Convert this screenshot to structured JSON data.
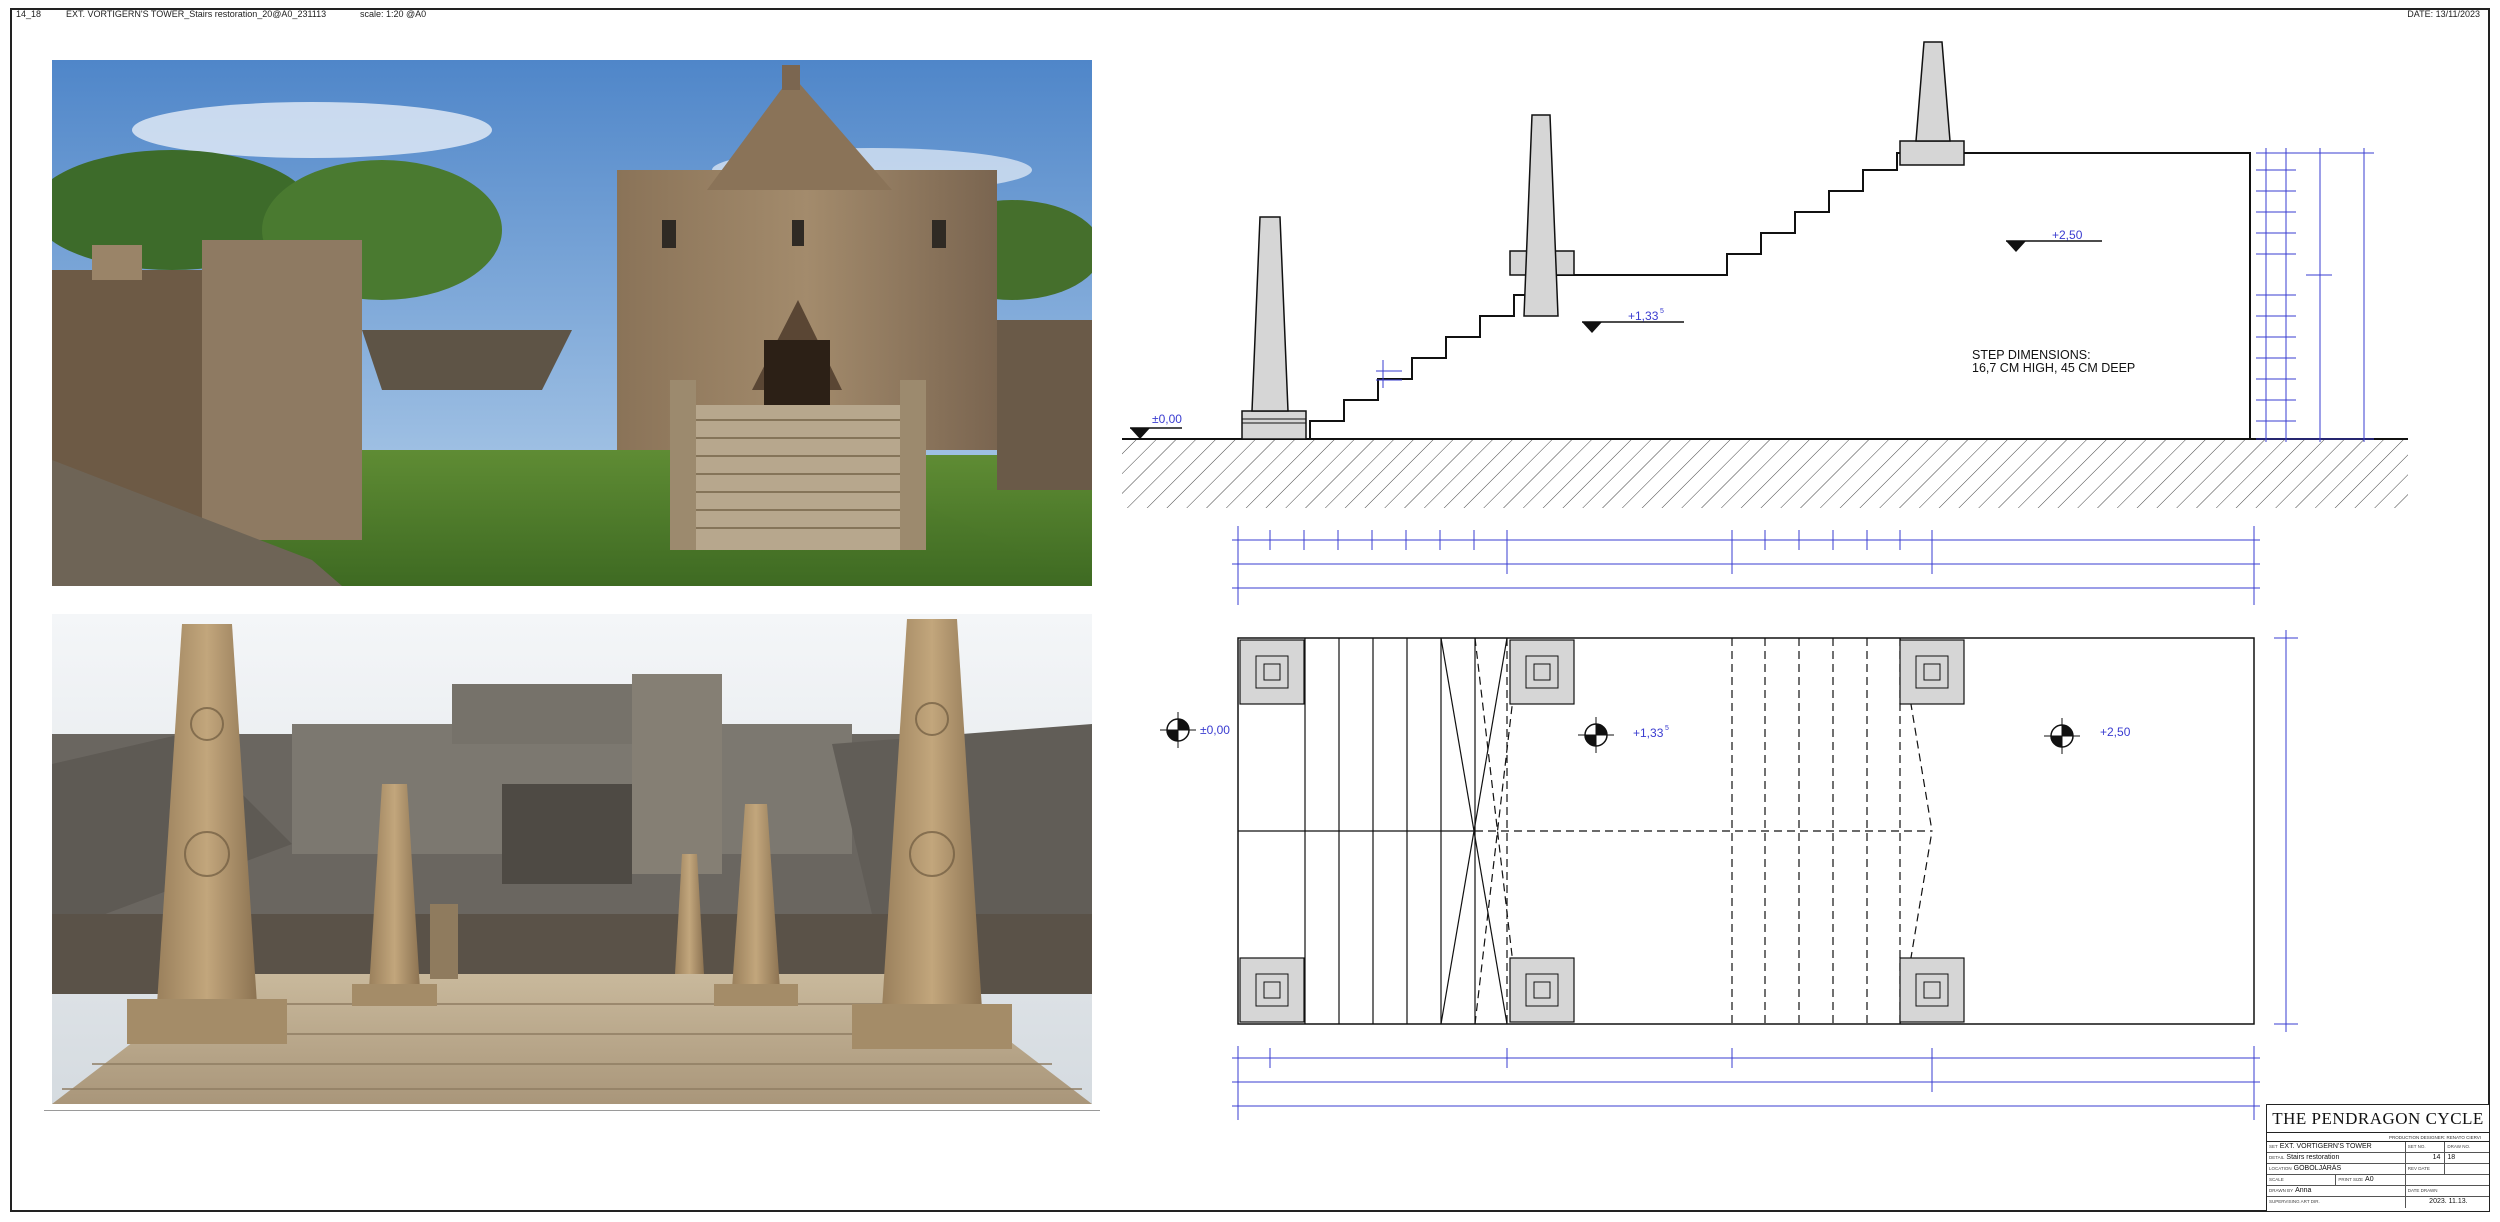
{
  "header": {
    "sheet_code": "14_18",
    "sheet_title": "EXT. VORTIGERN'S TOWER_Stairs restoration_20@A0_231113",
    "scale": "scale: 1:20 @A0",
    "date": "DATE: 13/11/2023"
  },
  "photos": [
    {
      "subject": "reference photo: stone tower facade with wide stone stairs and wooden palisade"
    },
    {
      "subject": "reference photo: carved stone obelisks on wooden deck in front of fortified gate"
    }
  ],
  "elevation": {
    "levels": {
      "ground": "±0,00",
      "mid": "+1,33",
      "mid_sup": "5",
      "top": "+2,50"
    },
    "note_line1": "STEP DIMENSIONS:",
    "note_line2": "16,7 CM HIGH, 45 CM DEEP"
  },
  "plan": {
    "levels": {
      "ground": "±0,00",
      "mid": "+1,33",
      "mid_sup": "5",
      "top": "+2,50"
    }
  },
  "title_block": {
    "production": "THE PENDRAGON CYCLE",
    "sub": "PRODUCTION DESIGNER: RENATO CIERVI",
    "set_label": "SET",
    "set": "EXT. VORTIGERN'S TOWER",
    "set_no_label": "SET NO.",
    "set_no": "14",
    "draw_no_label": "DRAW NO.",
    "draw_no": "18",
    "detail_label": "DETAIL",
    "detail": "Stairs restoration",
    "location_label": "LOCATION",
    "location": "GÖBÖLJÁRÁS",
    "rev_label": "REV DATE",
    "scale_label": "SCALE",
    "print_size_label": "PRINT SIZE",
    "print_size": "A0",
    "drawn_label": "DRAWN BY",
    "drawn": "Anna",
    "date_label": "DATE DRAWN",
    "date": "2023. 11.13.",
    "sup_label": "SUPERVISING ART DIR."
  }
}
